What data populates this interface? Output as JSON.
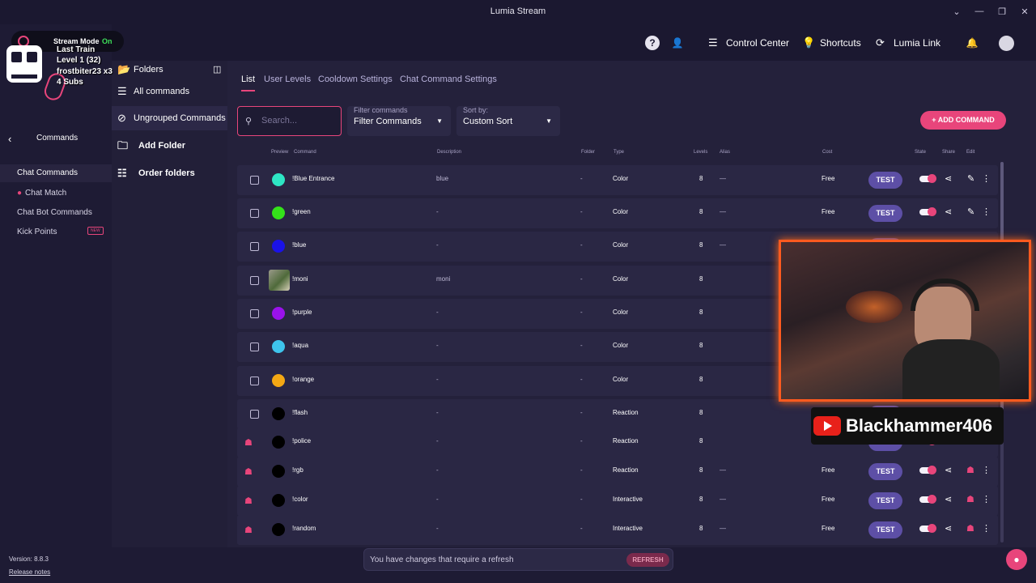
{
  "window": {
    "title": "Lumia Stream",
    "controls": [
      "⌄",
      "—",
      "❐",
      "✕"
    ]
  },
  "overlay": {
    "stream_mode_label": "Stream Mode",
    "stream_mode_value": "On",
    "train_title": "Last Train",
    "train_level": "Level 1  (32)",
    "train_user": "frostbiter23 x3",
    "train_subs": "4 Subs",
    "channel_name": "Blackhammer406"
  },
  "topbar": {
    "control_center": "Control Center",
    "shortcuts": "Shortcuts",
    "lumia_link": "Lumia Link"
  },
  "leftnav": {
    "back_label": "Commands",
    "items": [
      {
        "label": "Chat Commands"
      },
      {
        "label": "Chat Match"
      },
      {
        "label": "Chat Bot Commands"
      },
      {
        "label": "Kick Points",
        "badge": "NEW"
      }
    ],
    "version": "Version: 8.8.3",
    "release_notes": "Release notes"
  },
  "folders": {
    "title": "Folders",
    "items": [
      "All commands",
      "Ungrouped Commands",
      "Add Folder",
      "Order folders"
    ]
  },
  "tabs": [
    "List",
    "User Levels",
    "Cooldown Settings",
    "Chat Command Settings"
  ],
  "filters": {
    "search_placeholder": "Search...",
    "filter_label": "Filter commands",
    "filter_value": "Filter Commands",
    "sort_label": "Sort by:",
    "sort_value": "Custom Sort"
  },
  "add_command": "+ ADD COMMAND",
  "columns": [
    "Preview",
    "Command",
    "Description",
    "Folder",
    "Type",
    "Levels",
    "Alias",
    "Cost",
    "State",
    "Share",
    "Edit"
  ],
  "rows": [
    {
      "command": "!Blue Entrance",
      "description": "blue",
      "folder": "-",
      "type": "Color",
      "levels": "8",
      "alias": "—",
      "cost": "Free",
      "color": "#2ee6c4",
      "locked": false
    },
    {
      "command": "!green",
      "description": "-",
      "folder": "-",
      "type": "Color",
      "levels": "8",
      "alias": "—",
      "cost": "Free",
      "color": "#34e21a",
      "locked": false
    },
    {
      "command": "!blue",
      "description": "-",
      "folder": "-",
      "type": "Color",
      "levels": "8",
      "alias": "—",
      "cost": "",
      "color": "#1a12e8",
      "locked": false
    },
    {
      "command": "!moni",
      "description": "moni",
      "folder": "-",
      "type": "Color",
      "levels": "8",
      "alias": "",
      "cost": "",
      "color": "image",
      "locked": false
    },
    {
      "command": "!purple",
      "description": "-",
      "folder": "-",
      "type": "Color",
      "levels": "8",
      "alias": "",
      "cost": "",
      "color": "#9a12ec",
      "locked": false
    },
    {
      "command": "!aqua",
      "description": "-",
      "folder": "-",
      "type": "Color",
      "levels": "8",
      "alias": "",
      "cost": "",
      "color": "#3ec4ec",
      "locked": false
    },
    {
      "command": "!orange",
      "description": "-",
      "folder": "-",
      "type": "Color",
      "levels": "8",
      "alias": "",
      "cost": "",
      "color": "#f4a814",
      "locked": false
    },
    {
      "command": "!flash",
      "description": "-",
      "folder": "-",
      "type": "Reaction",
      "levels": "8",
      "alias": "",
      "cost": "",
      "color": "#000000",
      "locked": false
    },
    {
      "command": "!police",
      "description": "-",
      "folder": "-",
      "type": "Reaction",
      "levels": "8",
      "alias": "",
      "cost": "",
      "color": "#000000",
      "locked": true
    },
    {
      "command": "!rgb",
      "description": "-",
      "folder": "-",
      "type": "Reaction",
      "levels": "8",
      "alias": "—",
      "cost": "Free",
      "color": "#000000",
      "locked": true
    },
    {
      "command": "!color",
      "description": "-",
      "folder": "-",
      "type": "Interactive",
      "levels": "8",
      "alias": "—",
      "cost": "Free",
      "color": "#000000",
      "locked": true
    },
    {
      "command": "!random",
      "description": "-",
      "folder": "-",
      "type": "Interactive",
      "levels": "8",
      "alias": "—",
      "cost": "Free",
      "color": "#000000",
      "locked": true
    }
  ],
  "test_label": "TEST",
  "refresh": {
    "message": "You have changes that require a refresh",
    "button": "REFRESH"
  },
  "colors": {
    "accent": "#e8457b",
    "test_button": "#5d4fa6",
    "background": "#1b1830"
  }
}
